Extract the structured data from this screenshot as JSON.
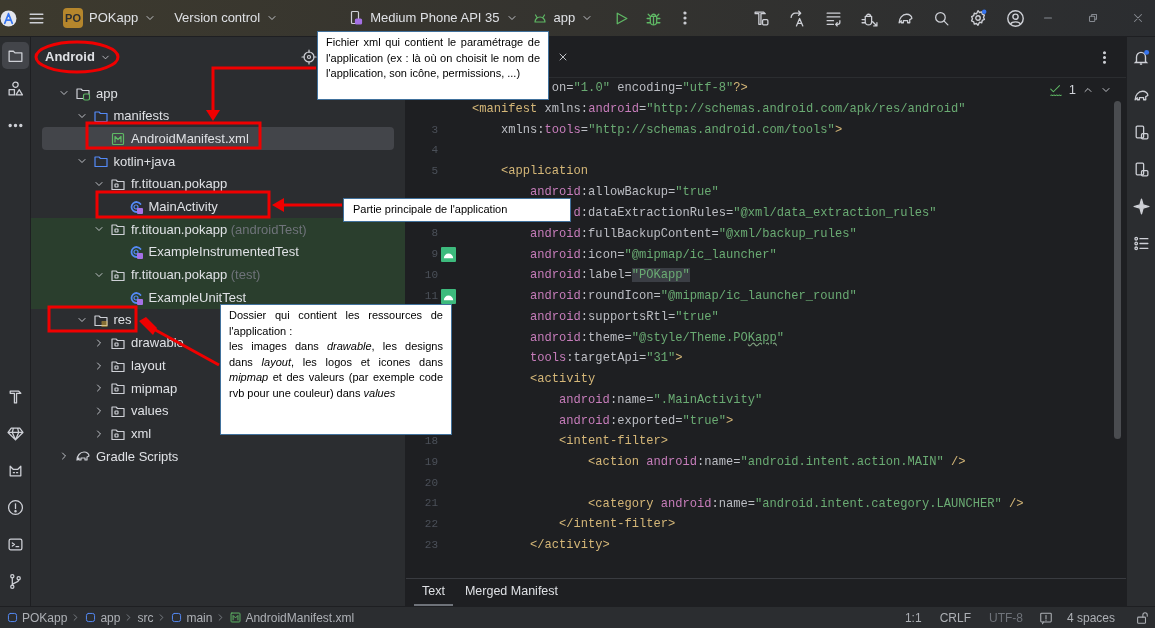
{
  "title_bar": {
    "project_badge": "PO",
    "project": "POKapp",
    "vcs": "Version control",
    "device": "Medium Phone API 35",
    "run_config": "app"
  },
  "project_panel": {
    "view": "Android",
    "tree": [
      {
        "label": "app",
        "kind": "module",
        "expanded": true,
        "selected": false,
        "test": false,
        "children": [
          {
            "label": "manifests",
            "kind": "folder",
            "expanded": true,
            "selected": false,
            "test": false,
            "children": [
              {
                "label": "AndroidManifest.xml",
                "kind": "manifest",
                "selected": true,
                "test": false
              }
            ]
          },
          {
            "label": "kotlin+java",
            "kind": "folder",
            "expanded": true,
            "selected": false,
            "test": false,
            "children": [
              {
                "label": "fr.titouan.pokapp",
                "kind": "package",
                "expanded": true,
                "selected": false,
                "test": false,
                "children": [
                  {
                    "label": "MainActivity",
                    "kind": "class",
                    "selected": false,
                    "test": false
                  }
                ]
              },
              {
                "label": "fr.titouan.pokapp",
                "suffix": "(androidTest)",
                "kind": "package",
                "expanded": true,
                "selected": false,
                "test": true,
                "children": [
                  {
                    "label": "ExampleInstrumentedTest",
                    "kind": "class",
                    "selected": false,
                    "test": true
                  }
                ]
              },
              {
                "label": "fr.titouan.pokapp",
                "suffix": "(test)",
                "kind": "package",
                "expanded": true,
                "selected": false,
                "test": true,
                "children": [
                  {
                    "label": "ExampleUnitTest",
                    "kind": "class",
                    "selected": false,
                    "test": true
                  }
                ]
              }
            ]
          },
          {
            "label": "res",
            "kind": "res",
            "expanded": true,
            "selected": false,
            "test": false,
            "children": [
              {
                "label": "drawable",
                "kind": "package",
                "expanded": false,
                "selected": false,
                "test": false
              },
              {
                "label": "layout",
                "kind": "package",
                "expanded": false,
                "selected": false,
                "test": false
              },
              {
                "label": "mipmap",
                "kind": "package",
                "expanded": false,
                "selected": false,
                "test": false
              },
              {
                "label": "values",
                "kind": "package",
                "expanded": false,
                "selected": false,
                "test": false
              },
              {
                "label": "xml",
                "kind": "package",
                "expanded": false,
                "selected": false,
                "test": false
              }
            ]
          }
        ]
      },
      {
        "label": "Gradle Scripts",
        "kind": "gradle",
        "expanded": false,
        "selected": false,
        "test": false
      }
    ]
  },
  "editor": {
    "inspection_count": "1",
    "lines": [
      {
        "segments": [
          {
            "text": "           on",
            "kind": "plain"
          },
          {
            "text": "=",
            "kind": "plain"
          },
          {
            "text": "\"1.0\"",
            "kind": "str"
          },
          {
            "text": " encoding=",
            "kind": "plain"
          },
          {
            "text": "\"utf-8\"",
            "kind": "str"
          },
          {
            "text": "?>",
            "kind": "tag"
          }
        ]
      },
      {
        "segments": [
          {
            "text": "<manifest",
            "kind": "tag"
          },
          {
            "text": " xmlns:",
            "kind": "plain"
          },
          {
            "text": "android",
            "kind": "ns"
          },
          {
            "text": "=",
            "kind": "plain"
          },
          {
            "text": "\"http://schemas.android.com/apk/res/android\"",
            "kind": "str"
          }
        ]
      },
      {
        "number": "3",
        "segments": [
          {
            "text": "    xmlns:",
            "kind": "plain"
          },
          {
            "text": "tools",
            "kind": "ns"
          },
          {
            "text": "=",
            "kind": "plain"
          },
          {
            "text": "\"http://schemas.android.com/tools\"",
            "kind": "str"
          },
          {
            "text": ">",
            "kind": "tag"
          }
        ]
      },
      {
        "number": "4"
      },
      {
        "number": "5",
        "segments": [
          {
            "text": "    <application",
            "kind": "tag"
          }
        ]
      },
      {
        "segments": [
          {
            "text": "        android",
            "kind": "ns"
          },
          {
            "text": ":allowBackup=",
            "kind": "plain"
          },
          {
            "text": "\"true\"",
            "kind": "str"
          }
        ]
      },
      {
        "segments": [
          {
            "text": "              d",
            "kind": "ns"
          },
          {
            "text": ":dataExtractionRules=",
            "kind": "plain"
          },
          {
            "text": "\"@xml/data_extraction_rules\"",
            "kind": "str"
          }
        ]
      },
      {
        "number": "8",
        "segments": [
          {
            "text": "        android",
            "kind": "ns"
          },
          {
            "text": ":fullBackupContent=",
            "kind": "plain"
          },
          {
            "text": "\"@xml/backup_rules\"",
            "kind": "str"
          }
        ]
      },
      {
        "number": "9",
        "gutter_icon": true,
        "segments": [
          {
            "text": "        android",
            "kind": "ns"
          },
          {
            "text": ":icon=",
            "kind": "plain"
          },
          {
            "text": "\"@mipmap/ic_launcher\"",
            "kind": "str"
          }
        ]
      },
      {
        "number": "10",
        "segments": [
          {
            "text": "        android",
            "kind": "ns"
          },
          {
            "text": ":label=",
            "kind": "plain"
          },
          {
            "text": "\"POKapp\"",
            "kind": "str_occurrence"
          }
        ]
      },
      {
        "number": "11",
        "gutter_icon": true,
        "segments": [
          {
            "text": "        android",
            "kind": "ns"
          },
          {
            "text": ":roundIcon=",
            "kind": "plain"
          },
          {
            "text": "\"@mipmap/ic_launcher_round\"",
            "kind": "str"
          }
        ]
      },
      {
        "segments": [
          {
            "text": "        android",
            "kind": "ns"
          },
          {
            "text": ":supportsRtl=",
            "kind": "plain"
          },
          {
            "text": "\"true\"",
            "kind": "str"
          }
        ]
      },
      {
        "segments": [
          {
            "text": "        android",
            "kind": "ns"
          },
          {
            "text": ":theme=",
            "kind": "plain"
          },
          {
            "text": "\"@style/Theme.PO",
            "kind": "str"
          },
          {
            "text": "Kapp",
            "kind": "str_typo"
          },
          {
            "text": "\"",
            "kind": "str"
          }
        ]
      },
      {
        "segments": [
          {
            "text": "        tools",
            "kind": "ns"
          },
          {
            "text": ":targetApi=",
            "kind": "plain"
          },
          {
            "text": "\"31\"",
            "kind": "str"
          },
          {
            "text": ">",
            "kind": "tag"
          }
        ]
      },
      {
        "segments": [
          {
            "text": "        <activity",
            "kind": "tag"
          }
        ]
      },
      {
        "segments": [
          {
            "text": "            android",
            "kind": "ns"
          },
          {
            "text": ":name=",
            "kind": "plain"
          },
          {
            "text": "\".MainActivity\"",
            "kind": "str"
          }
        ]
      },
      {
        "segments": [
          {
            "text": "            android",
            "kind": "ns"
          },
          {
            "text": ":exported=",
            "kind": "plain"
          },
          {
            "text": "\"true\"",
            "kind": "str"
          },
          {
            "text": ">",
            "kind": "tag"
          }
        ]
      },
      {
        "number": "18",
        "segments": [
          {
            "text": "            <intent-filter>",
            "kind": "tag"
          }
        ]
      },
      {
        "number": "19",
        "segments": [
          {
            "text": "                <action",
            "kind": "tag"
          },
          {
            "text": " android",
            "kind": "ns"
          },
          {
            "text": ":name=",
            "kind": "plain"
          },
          {
            "text": "\"android.intent.action.MAIN\"",
            "kind": "str"
          },
          {
            "text": " />",
            "kind": "tag"
          }
        ]
      },
      {
        "number": "20"
      },
      {
        "number": "21",
        "segments": [
          {
            "text": "                <category",
            "kind": "tag"
          },
          {
            "text": " android",
            "kind": "ns"
          },
          {
            "text": ":name=",
            "kind": "plain"
          },
          {
            "text": "\"android.intent.category.LAUNCHER\"",
            "kind": "str"
          },
          {
            "text": " />",
            "kind": "tag"
          }
        ]
      },
      {
        "number": "22",
        "segments": [
          {
            "text": "            </intent-filter>",
            "kind": "tag"
          }
        ]
      },
      {
        "number": "23",
        "segments": [
          {
            "text": "        </activity>",
            "kind": "tag"
          }
        ]
      }
    ],
    "bottom_tabs": [
      {
        "label": "Text",
        "selected": true
      },
      {
        "label": "Merged Manifest",
        "selected": false
      }
    ]
  },
  "status_bar": {
    "breadcrumbs": [
      {
        "label": "POKapp",
        "kind": "module"
      },
      {
        "label": "app",
        "kind": "module"
      },
      {
        "label": "src",
        "kind": "plain"
      },
      {
        "label": "main",
        "kind": "module"
      },
      {
        "label": "AndroidManifest.xml",
        "kind": "manifest"
      }
    ],
    "position": "1:1",
    "line_separator": "CRLF",
    "encoding": "UTF-8",
    "indent": "4 spaces"
  },
  "callouts": [
    {
      "paragraphs": [
        "Fichier xml qui contient le paramétrage de l'application (ex : là où on choisit le nom de l'application, son icône, permissions, ...)"
      ]
    },
    {
      "paragraphs": [
        "Partie principale de l'application"
      ]
    },
    {
      "paragraphs": [
        "Dossier qui contient les ressources de l'application :",
        "les images dans *drawable*, les designs dans *layout*, les logos et icones dans *mipmap* et des valeurs (par exemple code rvb pour une couleur) dans *values*"
      ]
    }
  ]
}
